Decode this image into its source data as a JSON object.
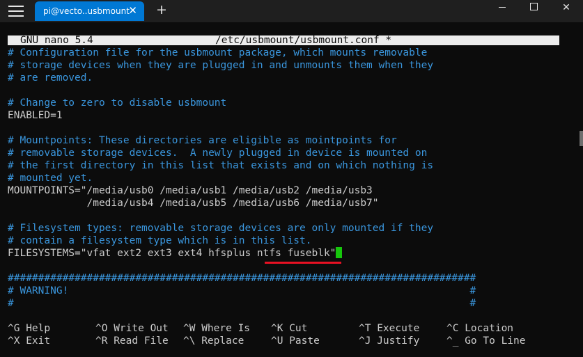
{
  "window": {
    "tab_title": "pi@vecto..usbmount",
    "tab_close": "✕",
    "new_tab": "+",
    "close_glyph": "✕"
  },
  "nano": {
    "version": "GNU nano 5.4",
    "filename": "/etc/usbmount/usbmount.conf *"
  },
  "lines": [
    "# Configuration file for the usbmount package, which mounts removable",
    "# storage devices when they are plugged in and unmounts them when they",
    "# are removed.",
    "",
    "# Change to zero to disable usbmount",
    "ENABLED=1",
    "",
    "# Mountpoints: These directories are eligible as mointpoints for",
    "# removable storage devices.  A newly plugged in device is mounted on",
    "# the first directory in this list that exists and on which nothing is",
    "# mounted yet.",
    "MOUNTPOINTS=\"/media/usb0 /media/usb1 /media/usb2 /media/usb3",
    "             /media/usb4 /media/usb5 /media/usb6 /media/usb7\"",
    "",
    "# Filesystem types: removable storage devices are only mounted if they",
    "# contain a filesystem type which is in this list.",
    "FILESYSTEMS=\"vfat ext2 ext3 ext4 hfsplus ntfs fuseblk\"",
    "",
    "#############################################################################",
    "# WARNING!                                                                  #",
    "#                                                                           #"
  ],
  "shortcuts": [
    {
      "key": "^G",
      "label": "Help"
    },
    {
      "key": "^X",
      "label": "Exit"
    },
    {
      "key": "^O",
      "label": "Write Out"
    },
    {
      "key": "^R",
      "label": "Read File"
    },
    {
      "key": "^W",
      "label": "Where Is"
    },
    {
      "key": "^\\",
      "label": "Replace"
    },
    {
      "key": "^K",
      "label": "Cut"
    },
    {
      "key": "^U",
      "label": "Paste"
    },
    {
      "key": "^T",
      "label": "Execute"
    },
    {
      "key": "^J",
      "label": "Justify"
    },
    {
      "key": "^C",
      "label": "Location"
    },
    {
      "key": "^_",
      "label": "Go To Line"
    }
  ],
  "colors": {
    "background": "#0c0c0c",
    "tab_accent": "#0078d4",
    "comment": "#3a96dd",
    "text": "#cccccc",
    "cursor": "#16c60c",
    "annotation_underline": "#e81123"
  }
}
